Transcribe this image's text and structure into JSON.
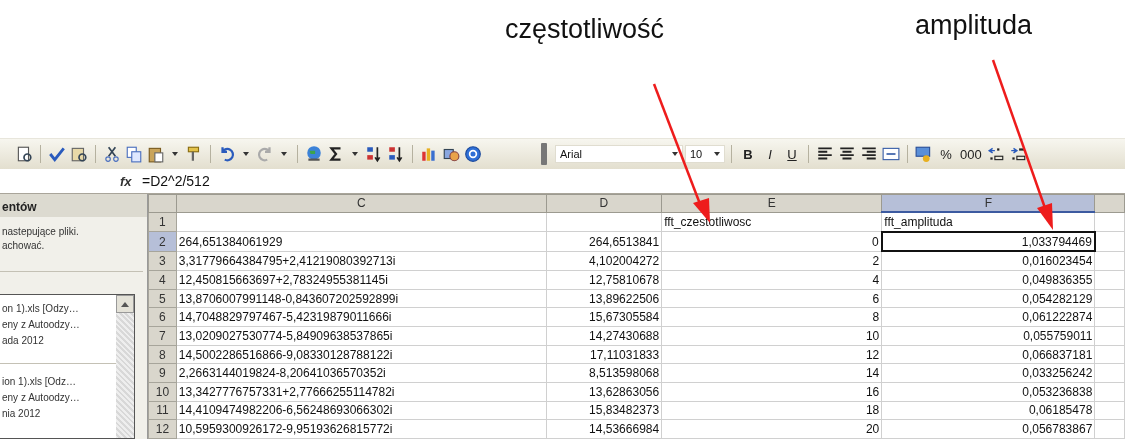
{
  "annotations": [
    {
      "label": "częstotliwość"
    },
    {
      "label": "amplituda"
    }
  ],
  "toolbar": {
    "font": "Arial",
    "size": "10",
    "format_buttons": [
      "B",
      "I",
      "U"
    ],
    "number_buttons": [
      "%",
      "000"
    ]
  },
  "formula_bar": {
    "label": "fx",
    "formula": "=D2^2/512"
  },
  "task_pane": {
    "title": "entów",
    "description": [
      "nastepujące pliki.",
      "achować."
    ],
    "files": [
      {
        "lines": [
          "on 1).xls  [Odzy…",
          "eny z Autoodzy…",
          "ada 2012"
        ]
      },
      {
        "lines": [
          "ion 1).xls  [Odz…",
          "eny z Autoodzy…",
          "nia 2012"
        ]
      }
    ]
  },
  "sheet": {
    "columns": [
      {
        "label": "C",
        "selected": false
      },
      {
        "label": "D",
        "selected": false
      },
      {
        "label": "E",
        "selected": false
      },
      {
        "label": "F",
        "selected": true
      }
    ],
    "rows": [
      {
        "header": "1",
        "selected": false,
        "cells": [
          {
            "selected": false
          },
          {
            "selected": false
          },
          {
            "text": "fft_czestotliwosc",
            "selected": false
          },
          {
            "text": "fft_amplituda",
            "selected": false
          }
        ]
      },
      {
        "header": "2",
        "selected": true,
        "cells": [
          {
            "text": "264,651384061929",
            "selected": false
          },
          {
            "text": "264,6513841",
            "selected": false
          },
          {
            "text": "0",
            "selected": false
          },
          {
            "text": "1,033794469",
            "selected": true
          }
        ]
      },
      {
        "header": "3",
        "selected": false,
        "cells": [
          {
            "text": "3,31779664384795+2,41219080392713i",
            "selected": false
          },
          {
            "text": "4,102004272",
            "selected": false
          },
          {
            "text": "2",
            "selected": false
          },
          {
            "text": "0,016023454",
            "selected": false
          }
        ]
      },
      {
        "header": "4",
        "selected": false,
        "cells": [
          {
            "text": "12,450815663697+2,78324955381145i",
            "selected": false
          },
          {
            "text": "12,75810678",
            "selected": false
          },
          {
            "text": "4",
            "selected": false
          },
          {
            "text": "0,049836355",
            "selected": false
          }
        ]
      },
      {
        "header": "5",
        "selected": false,
        "cells": [
          {
            "text": "13,8706007991148-0,843607202592899i",
            "selected": false
          },
          {
            "text": "13,89622506",
            "selected": false
          },
          {
            "text": "6",
            "selected": false
          },
          {
            "text": "0,054282129",
            "selected": false
          }
        ]
      },
      {
        "header": "6",
        "selected": false,
        "cells": [
          {
            "text": "14,7048829797467-5,42319879011666i",
            "selected": false
          },
          {
            "text": "15,67305584",
            "selected": false
          },
          {
            "text": "8",
            "selected": false
          },
          {
            "text": "0,061222874",
            "selected": false
          }
        ]
      },
      {
        "header": "7",
        "selected": false,
        "cells": [
          {
            "text": "13,0209027530774-5,84909638537865i",
            "selected": false
          },
          {
            "text": "14,27430688",
            "selected": false
          },
          {
            "text": "10",
            "selected": false
          },
          {
            "text": "0,055759011",
            "selected": false
          }
        ]
      },
      {
        "header": "8",
        "selected": false,
        "cells": [
          {
            "text": "14,5002286516866-9,08330128788122i",
            "selected": false
          },
          {
            "text": "17,11031833",
            "selected": false
          },
          {
            "text": "12",
            "selected": false
          },
          {
            "text": "0,066837181",
            "selected": false
          }
        ]
      },
      {
        "header": "9",
        "selected": false,
        "cells": [
          {
            "text": "2,2663144019824-8,20641036570352i",
            "selected": false
          },
          {
            "text": "8,513598068",
            "selected": false
          },
          {
            "text": "14",
            "selected": false
          },
          {
            "text": "0,033256242",
            "selected": false
          }
        ]
      },
      {
        "header": "10",
        "selected": false,
        "cells": [
          {
            "text": "13,3427776757331+2,77666255114782i",
            "selected": false
          },
          {
            "text": "13,62863056",
            "selected": false
          },
          {
            "text": "16",
            "selected": false
          },
          {
            "text": "0,053236838",
            "selected": false
          }
        ]
      },
      {
        "header": "11",
        "selected": false,
        "cells": [
          {
            "text": "14,4109474982206-6,56248693066302i",
            "selected": false
          },
          {
            "text": "15,83482373",
            "selected": false
          },
          {
            "text": "18",
            "selected": false
          },
          {
            "text": "0,06185478",
            "selected": false
          }
        ]
      },
      {
        "header": "12",
        "selected": false,
        "cells": [
          {
            "text": "10,5959300926172-9,95193626815772i",
            "selected": false
          },
          {
            "text": "14,53666984",
            "selected": false
          },
          {
            "text": "20",
            "selected": false
          },
          {
            "text": "0,056783867",
            "selected": false
          }
        ]
      }
    ]
  }
}
